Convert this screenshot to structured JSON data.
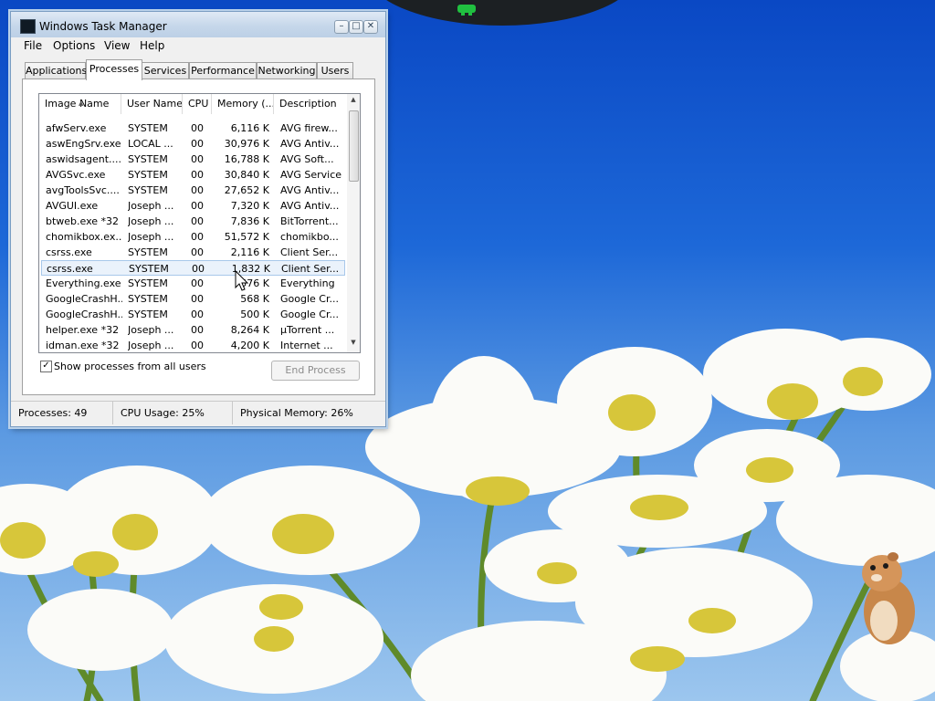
{
  "window": {
    "title": "Windows Task Manager",
    "controls": {
      "minimize": "–",
      "maximize": "□",
      "close": "✕"
    }
  },
  "menu": [
    "File",
    "Options",
    "View",
    "Help"
  ],
  "tabs": [
    "Applications",
    "Processes",
    "Services",
    "Performance",
    "Networking",
    "Users"
  ],
  "active_tab": "Processes",
  "columns": [
    "Image Name",
    "User Name",
    "CPU",
    "Memory (...",
    "Description"
  ],
  "processes": [
    {
      "name": "afwServ.exe",
      "user": "SYSTEM",
      "cpu": "00",
      "memory": "6,116 K",
      "description": "AVG firew..."
    },
    {
      "name": "aswEngSrv.exe",
      "user": "LOCAL ...",
      "cpu": "00",
      "memory": "30,976 K",
      "description": "AVG Antiv..."
    },
    {
      "name": "aswidsagent....",
      "user": "SYSTEM",
      "cpu": "00",
      "memory": "16,788 K",
      "description": "AVG Soft..."
    },
    {
      "name": "AVGSvc.exe",
      "user": "SYSTEM",
      "cpu": "00",
      "memory": "30,840 K",
      "description": "AVG Service"
    },
    {
      "name": "avgToolsSvc....",
      "user": "SYSTEM",
      "cpu": "00",
      "memory": "27,652 K",
      "description": "AVG Antiv..."
    },
    {
      "name": "AVGUI.exe",
      "user": "Joseph ...",
      "cpu": "00",
      "memory": "7,320 K",
      "description": "AVG Antiv..."
    },
    {
      "name": "btweb.exe *32",
      "user": "Joseph ...",
      "cpu": "00",
      "memory": "7,836 K",
      "description": "BitTorrent..."
    },
    {
      "name": "chomikbox.ex...",
      "user": "Joseph ...",
      "cpu": "00",
      "memory": "51,572 K",
      "description": "chomikbo..."
    },
    {
      "name": "csrss.exe",
      "user": "SYSTEM",
      "cpu": "00",
      "memory": "2,116 K",
      "description": "Client Ser..."
    },
    {
      "name": "csrss.exe",
      "user": "SYSTEM",
      "cpu": "00",
      "memory": "1,832 K",
      "description": "Client Ser...",
      "selected": true
    },
    {
      "name": "Everything.exe",
      "user": "SYSTEM",
      "cpu": "00",
      "memory": "576 K",
      "description": "Everything"
    },
    {
      "name": "GoogleCrashH...",
      "user": "SYSTEM",
      "cpu": "00",
      "memory": "568 K",
      "description": "Google Cr..."
    },
    {
      "name": "GoogleCrashH...",
      "user": "SYSTEM",
      "cpu": "00",
      "memory": "500 K",
      "description": "Google Cr..."
    },
    {
      "name": "helper.exe *32",
      "user": "Joseph ...",
      "cpu": "00",
      "memory": "8,264 K",
      "description": "µTorrent ..."
    },
    {
      "name": "idman.exe *32",
      "user": "Joseph ...",
      "cpu": "00",
      "memory": "4,200 K",
      "description": "Internet ..."
    }
  ],
  "show_all_label": "Show processes from all users",
  "show_all_checked": true,
  "end_process_label": "End Process",
  "status": {
    "processes": "Processes: 49",
    "cpu": "CPU Usage: 25%",
    "memory": "Physical Memory: 26%"
  },
  "colors": {
    "sky_top": "#0a48c4",
    "sky_bottom": "#9cc6ee",
    "selection": "#eaf2fb",
    "titlebar": "#c6d7ea"
  }
}
